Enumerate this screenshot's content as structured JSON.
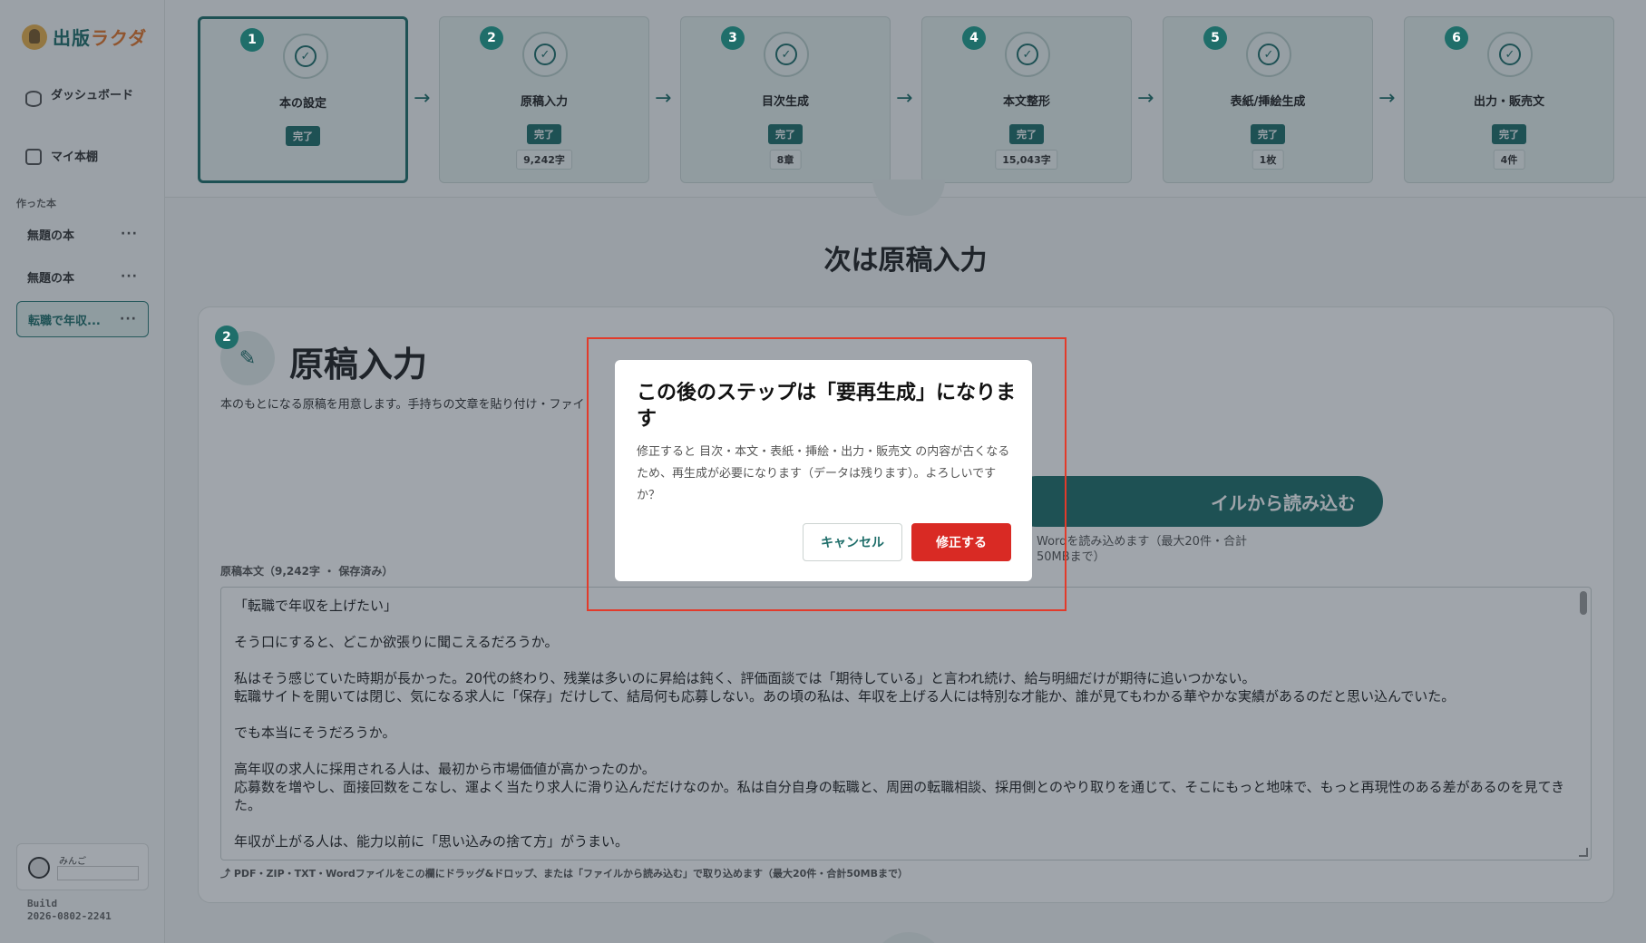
{
  "app": {
    "logo_part1": "出版",
    "logo_part2": "ラクダ"
  },
  "sidebar": {
    "nav": [
      {
        "label": "ダッシュボード",
        "icon": "database-icon"
      },
      {
        "label": "マイ本棚",
        "icon": "books-icon"
      }
    ],
    "section_label": "作った本",
    "books": [
      {
        "label": "無題の本",
        "more": "···"
      },
      {
        "label": "無題の本",
        "more": "···"
      },
      {
        "label": "転職で年収...",
        "more": "···",
        "active": true
      }
    ],
    "user": {
      "name": "みんご"
    },
    "build_label": "Build",
    "build_id": "2026-0802-2241"
  },
  "steps": [
    {
      "num": "1",
      "title": "本の設定",
      "badge": "完了",
      "count": ""
    },
    {
      "num": "2",
      "title": "原稿入力",
      "badge": "完了",
      "count": "9,242字"
    },
    {
      "num": "3",
      "title": "目次生成",
      "badge": "完了",
      "count": "8章"
    },
    {
      "num": "4",
      "title": "本文整形",
      "badge": "完了",
      "count": "15,043字"
    },
    {
      "num": "5",
      "title": "表紙/挿絵生成",
      "badge": "完了",
      "count": "1枚"
    },
    {
      "num": "6",
      "title": "出力・販売文",
      "badge": "完了",
      "count": "4件"
    }
  ],
  "main": {
    "next_title": "次は原稿入力",
    "card": {
      "num": "2",
      "title": "原稿入力",
      "description": "本のもとになる原稿を用意します。手持ちの文章を貼り付け・ファイ",
      "file_button": "イルから読み込む",
      "file_note": "Wordを読み込めます（最大20件・合計50MBまで）",
      "manuscript_label": "原稿本文（9,242字 ・ 保存済み）",
      "manuscript_lines": [
        "「転職で年収を上げたい」",
        "",
        "そう口にすると、どこか欲張りに聞こえるだろうか。",
        "",
        "私はそう感じていた時期が長かった。20代の終わり、残業は多いのに昇給は鈍く、評価面談では「期待している」と言われ続け、給与明細だけが期待に追いつかない。",
        "転職サイトを開いては閉じ、気になる求人に「保存」だけして、結局何も応募しない。あの頃の私は、年収を上げる人には特別な才能か、誰が見てもわかる華やかな実績があるのだと思い込んでいた。",
        "",
        "でも本当にそうだろうか。",
        "",
        "高年収の求人に採用される人は、最初から市場価値が高かったのか。",
        "応募数を増やし、面接回数をこなし、運よく当たり求人に滑り込んだだけなのか。私は自分自身の転職と、周囲の転職相談、採用側とのやり取りを通じて、そこにもっと地味で、もっと再現性のある差があるのを見てきた。",
        "",
        "年収が上がる人は、能力以前に「思い込みの捨て方」がうまい。"
      ],
      "drop_hint": "PDF・ZIP・TXT・Wordファイルをこの欄にドラッグ&ドロップ、または「ファイルから読み込む」で取り込めます（最大20件・合計50MBまで）"
    }
  },
  "modal": {
    "title": "この後のステップは「要再生成」になります",
    "body": "修正すると 目次・本文・表紙・挿絵・出力・販売文 の内容が古くなるため、再生成が必要になります（データは残ります）。よろしいですか？",
    "cancel_label": "キャンセル",
    "confirm_label": "修正する"
  },
  "colors": {
    "accent": "#1f6e6a",
    "danger": "#d92a24",
    "highlight": "#e23b2b"
  }
}
